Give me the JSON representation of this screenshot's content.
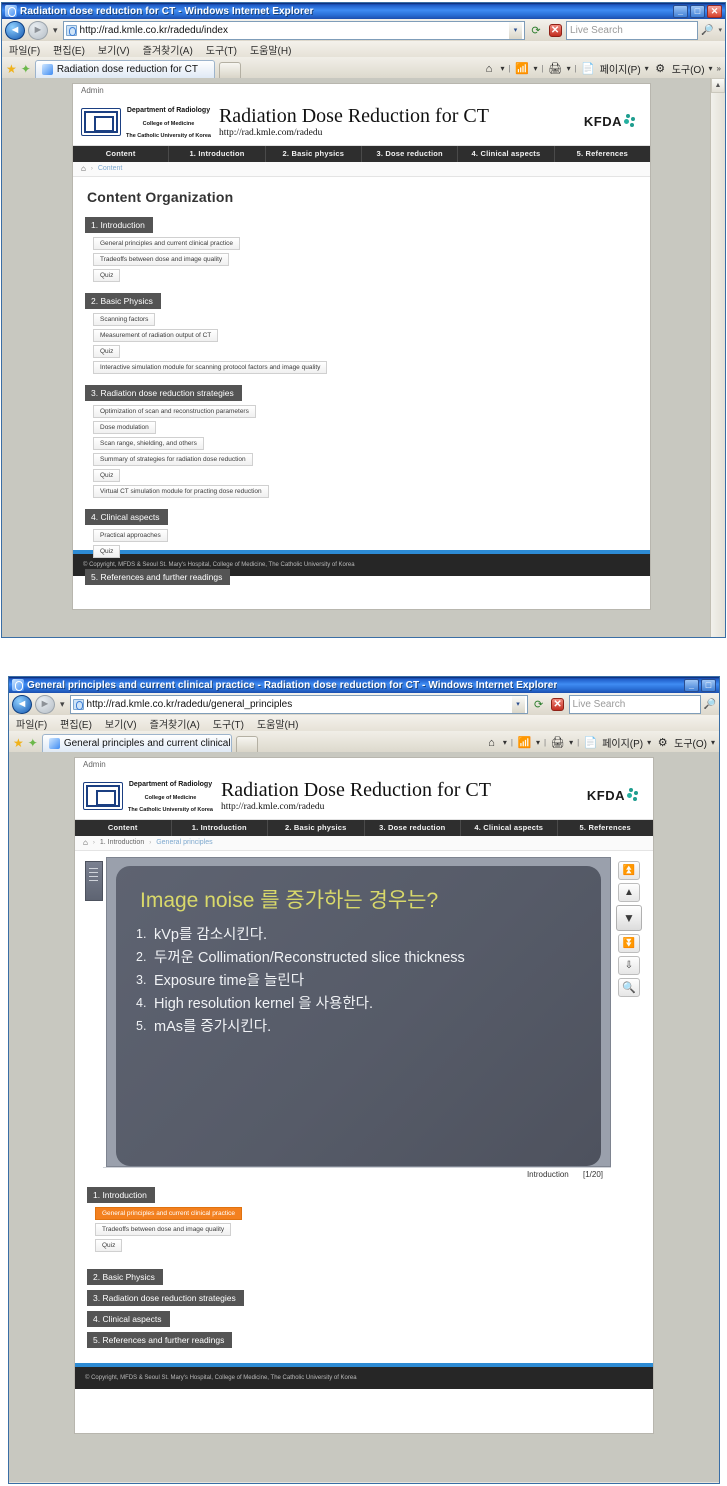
{
  "window1": {
    "title": "Radiation dose reduction for CT - Windows Internet Explorer",
    "url": "http://rad.kmle.co.kr/radedu/index",
    "search_placeholder": "Live Search",
    "menu": [
      "파일(F)",
      "편집(E)",
      "보기(V)",
      "즐겨찾기(A)",
      "도구(T)",
      "도움말(H)"
    ],
    "tab_label": "Radiation dose reduction for CT",
    "tools": {
      "page": "페이지(P)",
      "tools": "도구(O)"
    },
    "buttons": {
      "minimize": "_",
      "maximize": "□",
      "close": "✕"
    }
  },
  "window2": {
    "title": "General principles and current clinical practice - Radiation dose reduction for CT - Windows Internet Explorer",
    "url": "http://rad.kmle.co.kr/radedu/general_principles",
    "search_placeholder": "Live Search",
    "menu": [
      "파일(F)",
      "편집(E)",
      "보기(V)",
      "즐겨찾기(A)",
      "도구(T)",
      "도움말(H)"
    ],
    "tab_label": "General principles and current clinical practic...",
    "tools": {
      "page": "페이지(P)",
      "tools": "도구(O)"
    },
    "buttons": {
      "minimize": "_",
      "maximize": "□"
    }
  },
  "site": {
    "admin_label": "Admin",
    "logo": {
      "line1": "Department of Radiology",
      "line2": "College of Medicine",
      "line3": "The Catholic University of Korea"
    },
    "title": "Radiation Dose Reduction for CT",
    "url": "http://rad.kmle.com/radedu",
    "kfda": "KFDA",
    "nav": [
      "Content",
      "1. Introduction",
      "2. Basic physics",
      "3. Dose reduction",
      "4. Clinical aspects",
      "5. References"
    ],
    "footer": "© Copyright, MFDS & Seoul St. Mary's Hospital, College of Medicine, The Catholic University of Korea",
    "accent_color": "#2d8bd4",
    "active_color": "#f3801f",
    "section_header_color": "#545454"
  },
  "page1": {
    "breadcrumb": {
      "home": "⌂",
      "sep": "›",
      "current": "Content"
    },
    "heading": "Content Organization",
    "sections": [
      {
        "title": "1. Introduction",
        "items": [
          "General principles and current clinical practice",
          "Tradeoffs between dose and image quality",
          "Quiz"
        ]
      },
      {
        "title": "2. Basic Physics",
        "items": [
          "Scanning factors",
          "Measurement of radiation output of CT",
          "Quiz",
          "Interactive simulation module for scanning protocol factors and image quality"
        ]
      },
      {
        "title": "3. Radiation dose reduction strategies",
        "items": [
          "Optimization of scan and reconstruction parameters",
          "Dose modulation",
          "Scan range, shielding, and others",
          "Summary of strategies for radiation dose reduction",
          "Quiz",
          "Virtual CT simulation module for practing dose reduction"
        ]
      },
      {
        "title": "4. Clinical aspects",
        "items": [
          "Practical approaches",
          "Quiz"
        ]
      },
      {
        "title": "5. References and further readings",
        "items": []
      }
    ]
  },
  "page2": {
    "breadcrumb": {
      "home": "⌂",
      "sep": "›",
      "parent": "1. Introduction",
      "current": "General principles"
    },
    "slide": {
      "question": "Image noise 를  증가하는 경우는?",
      "items": [
        {
          "num": "1.",
          "text": "kVp를 감소시킨다."
        },
        {
          "num": "2.",
          "text": "두꺼운 Collimation/Reconstructed slice thickness"
        },
        {
          "num": "3.",
          "text": "Exposure time을 늘린다"
        },
        {
          "num": "4.",
          "text": "High resolution kernel 을 사용한다."
        },
        {
          "num": "5.",
          "text": "mAs를 증가시킨다."
        }
      ],
      "footer_label": "Introduction",
      "page_indicator": "[1/20]"
    },
    "controls": [
      {
        "name": "first-slide-button",
        "glyph": "⏫"
      },
      {
        "name": "previous-slide-button",
        "glyph": "▲"
      },
      {
        "name": "next-slide-button",
        "glyph": "▼"
      },
      {
        "name": "last-slide-button",
        "glyph": "⏬"
      },
      {
        "name": "jump-down-button",
        "glyph": "⇩"
      },
      {
        "name": "zoom-search-button",
        "glyph": "🔍"
      }
    ],
    "sections": [
      {
        "title": "1. Introduction",
        "items": [
          {
            "label": "General principles and current clinical practice",
            "active": true
          },
          {
            "label": "Tradeoffs between dose and image quality",
            "active": false
          },
          {
            "label": "Quiz",
            "active": false
          }
        ]
      },
      {
        "title": "2. Basic Physics",
        "items": []
      },
      {
        "title": "3. Radiation dose reduction strategies",
        "items": []
      },
      {
        "title": "4. Clinical aspects",
        "items": []
      },
      {
        "title": "5. References and further readings",
        "items": []
      }
    ]
  }
}
